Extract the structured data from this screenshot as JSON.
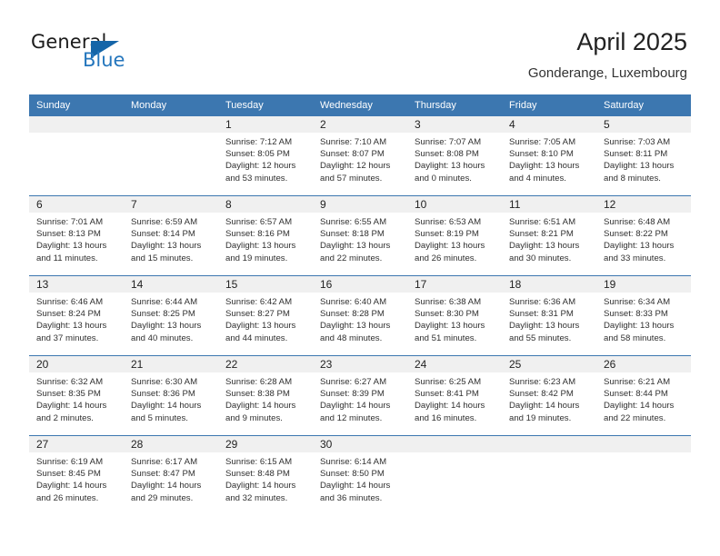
{
  "brand": {
    "word_one": "General",
    "word_two": "Blue",
    "logo_icon": "triangle-logo-icon"
  },
  "header": {
    "title": "April 2025",
    "location": "Gonderange, Luxembourg"
  },
  "colors": {
    "header_blue": "#3c77b0",
    "brand_blue": "#2476bd",
    "daynum_band": "#f0f0f0",
    "text": "#303030"
  },
  "weekday_headers": [
    "Sunday",
    "Monday",
    "Tuesday",
    "Wednesday",
    "Thursday",
    "Friday",
    "Saturday"
  ],
  "weeks": [
    [
      {
        "day": "",
        "sunrise": "",
        "sunset": "",
        "daylight_line1": "",
        "daylight_line2": ""
      },
      {
        "day": "",
        "sunrise": "",
        "sunset": "",
        "daylight_line1": "",
        "daylight_line2": ""
      },
      {
        "day": "1",
        "sunrise": "Sunrise: 7:12 AM",
        "sunset": "Sunset: 8:05 PM",
        "daylight_line1": "Daylight: 12 hours",
        "daylight_line2": "and 53 minutes."
      },
      {
        "day": "2",
        "sunrise": "Sunrise: 7:10 AM",
        "sunset": "Sunset: 8:07 PM",
        "daylight_line1": "Daylight: 12 hours",
        "daylight_line2": "and 57 minutes."
      },
      {
        "day": "3",
        "sunrise": "Sunrise: 7:07 AM",
        "sunset": "Sunset: 8:08 PM",
        "daylight_line1": "Daylight: 13 hours",
        "daylight_line2": "and 0 minutes."
      },
      {
        "day": "4",
        "sunrise": "Sunrise: 7:05 AM",
        "sunset": "Sunset: 8:10 PM",
        "daylight_line1": "Daylight: 13 hours",
        "daylight_line2": "and 4 minutes."
      },
      {
        "day": "5",
        "sunrise": "Sunrise: 7:03 AM",
        "sunset": "Sunset: 8:11 PM",
        "daylight_line1": "Daylight: 13 hours",
        "daylight_line2": "and 8 minutes."
      }
    ],
    [
      {
        "day": "6",
        "sunrise": "Sunrise: 7:01 AM",
        "sunset": "Sunset: 8:13 PM",
        "daylight_line1": "Daylight: 13 hours",
        "daylight_line2": "and 11 minutes."
      },
      {
        "day": "7",
        "sunrise": "Sunrise: 6:59 AM",
        "sunset": "Sunset: 8:14 PM",
        "daylight_line1": "Daylight: 13 hours",
        "daylight_line2": "and 15 minutes."
      },
      {
        "day": "8",
        "sunrise": "Sunrise: 6:57 AM",
        "sunset": "Sunset: 8:16 PM",
        "daylight_line1": "Daylight: 13 hours",
        "daylight_line2": "and 19 minutes."
      },
      {
        "day": "9",
        "sunrise": "Sunrise: 6:55 AM",
        "sunset": "Sunset: 8:18 PM",
        "daylight_line1": "Daylight: 13 hours",
        "daylight_line2": "and 22 minutes."
      },
      {
        "day": "10",
        "sunrise": "Sunrise: 6:53 AM",
        "sunset": "Sunset: 8:19 PM",
        "daylight_line1": "Daylight: 13 hours",
        "daylight_line2": "and 26 minutes."
      },
      {
        "day": "11",
        "sunrise": "Sunrise: 6:51 AM",
        "sunset": "Sunset: 8:21 PM",
        "daylight_line1": "Daylight: 13 hours",
        "daylight_line2": "and 30 minutes."
      },
      {
        "day": "12",
        "sunrise": "Sunrise: 6:48 AM",
        "sunset": "Sunset: 8:22 PM",
        "daylight_line1": "Daylight: 13 hours",
        "daylight_line2": "and 33 minutes."
      }
    ],
    [
      {
        "day": "13",
        "sunrise": "Sunrise: 6:46 AM",
        "sunset": "Sunset: 8:24 PM",
        "daylight_line1": "Daylight: 13 hours",
        "daylight_line2": "and 37 minutes."
      },
      {
        "day": "14",
        "sunrise": "Sunrise: 6:44 AM",
        "sunset": "Sunset: 8:25 PM",
        "daylight_line1": "Daylight: 13 hours",
        "daylight_line2": "and 40 minutes."
      },
      {
        "day": "15",
        "sunrise": "Sunrise: 6:42 AM",
        "sunset": "Sunset: 8:27 PM",
        "daylight_line1": "Daylight: 13 hours",
        "daylight_line2": "and 44 minutes."
      },
      {
        "day": "16",
        "sunrise": "Sunrise: 6:40 AM",
        "sunset": "Sunset: 8:28 PM",
        "daylight_line1": "Daylight: 13 hours",
        "daylight_line2": "and 48 minutes."
      },
      {
        "day": "17",
        "sunrise": "Sunrise: 6:38 AM",
        "sunset": "Sunset: 8:30 PM",
        "daylight_line1": "Daylight: 13 hours",
        "daylight_line2": "and 51 minutes."
      },
      {
        "day": "18",
        "sunrise": "Sunrise: 6:36 AM",
        "sunset": "Sunset: 8:31 PM",
        "daylight_line1": "Daylight: 13 hours",
        "daylight_line2": "and 55 minutes."
      },
      {
        "day": "19",
        "sunrise": "Sunrise: 6:34 AM",
        "sunset": "Sunset: 8:33 PM",
        "daylight_line1": "Daylight: 13 hours",
        "daylight_line2": "and 58 minutes."
      }
    ],
    [
      {
        "day": "20",
        "sunrise": "Sunrise: 6:32 AM",
        "sunset": "Sunset: 8:35 PM",
        "daylight_line1": "Daylight: 14 hours",
        "daylight_line2": "and 2 minutes."
      },
      {
        "day": "21",
        "sunrise": "Sunrise: 6:30 AM",
        "sunset": "Sunset: 8:36 PM",
        "daylight_line1": "Daylight: 14 hours",
        "daylight_line2": "and 5 minutes."
      },
      {
        "day": "22",
        "sunrise": "Sunrise: 6:28 AM",
        "sunset": "Sunset: 8:38 PM",
        "daylight_line1": "Daylight: 14 hours",
        "daylight_line2": "and 9 minutes."
      },
      {
        "day": "23",
        "sunrise": "Sunrise: 6:27 AM",
        "sunset": "Sunset: 8:39 PM",
        "daylight_line1": "Daylight: 14 hours",
        "daylight_line2": "and 12 minutes."
      },
      {
        "day": "24",
        "sunrise": "Sunrise: 6:25 AM",
        "sunset": "Sunset: 8:41 PM",
        "daylight_line1": "Daylight: 14 hours",
        "daylight_line2": "and 16 minutes."
      },
      {
        "day": "25",
        "sunrise": "Sunrise: 6:23 AM",
        "sunset": "Sunset: 8:42 PM",
        "daylight_line1": "Daylight: 14 hours",
        "daylight_line2": "and 19 minutes."
      },
      {
        "day": "26",
        "sunrise": "Sunrise: 6:21 AM",
        "sunset": "Sunset: 8:44 PM",
        "daylight_line1": "Daylight: 14 hours",
        "daylight_line2": "and 22 minutes."
      }
    ],
    [
      {
        "day": "27",
        "sunrise": "Sunrise: 6:19 AM",
        "sunset": "Sunset: 8:45 PM",
        "daylight_line1": "Daylight: 14 hours",
        "daylight_line2": "and 26 minutes."
      },
      {
        "day": "28",
        "sunrise": "Sunrise: 6:17 AM",
        "sunset": "Sunset: 8:47 PM",
        "daylight_line1": "Daylight: 14 hours",
        "daylight_line2": "and 29 minutes."
      },
      {
        "day": "29",
        "sunrise": "Sunrise: 6:15 AM",
        "sunset": "Sunset: 8:48 PM",
        "daylight_line1": "Daylight: 14 hours",
        "daylight_line2": "and 32 minutes."
      },
      {
        "day": "30",
        "sunrise": "Sunrise: 6:14 AM",
        "sunset": "Sunset: 8:50 PM",
        "daylight_line1": "Daylight: 14 hours",
        "daylight_line2": "and 36 minutes."
      },
      {
        "day": "",
        "sunrise": "",
        "sunset": "",
        "daylight_line1": "",
        "daylight_line2": ""
      },
      {
        "day": "",
        "sunrise": "",
        "sunset": "",
        "daylight_line1": "",
        "daylight_line2": ""
      },
      {
        "day": "",
        "sunrise": "",
        "sunset": "",
        "daylight_line1": "",
        "daylight_line2": ""
      }
    ]
  ]
}
